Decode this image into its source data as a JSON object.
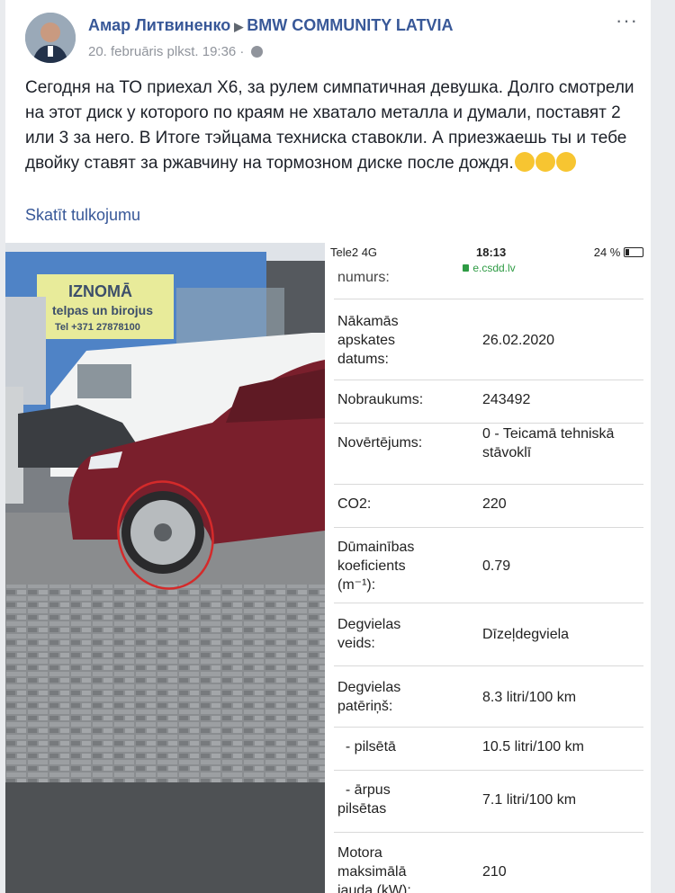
{
  "post": {
    "author": "Амар Литвиненко",
    "group": "BMW COMMUNITY LATVIA",
    "timestamp": "20. februāris plkst. 19:36 ·",
    "text": "Сегодня на ТО приехал X6, за рулем симпатичная девушка. Долго смотрели на этот диск у которого по краям не хватало металла и думали, поставят 2 или 3 за него. В Итоге тэйцама техниска ставокли. А приезжаешь ты и тебе двойку ставят за ржавчину на тормозном диске после дождя.",
    "see_translation": "Skatīt tulkojumu",
    "more_icon": "···"
  },
  "photo": {
    "sign_title": "IZNOMĀ",
    "sign_sub": "telpas un birojus",
    "sign_phone": "Tel +371 27878100"
  },
  "phone": {
    "carrier": "Tele2  4G",
    "time": "18:13",
    "battery": "24 %",
    "url": "e.csdd.lv",
    "cut_label": "numurs:",
    "rows": [
      {
        "label": "Nākamās\napskates\ndatums:",
        "value": "26.02.2020"
      },
      {
        "label": "Nobraukums:",
        "value": "243492"
      },
      {
        "label": "Novērtējums:",
        "value": "0 - Teicamā tehniskā\nstāvoklī"
      },
      {
        "label": "CO2:",
        "value": "220"
      },
      {
        "label": "Dūmainības\nkoeficients\n(m⁻¹):",
        "value": "0.79"
      },
      {
        "label": "Degvielas\nveids:",
        "value": "Dīzeļdegviela"
      },
      {
        "label": "Degvielas\npatēriņš:",
        "value": "8.3 litri/100 km"
      },
      {
        "label": "  - pilsētā",
        "value": "10.5 litri/100 km"
      },
      {
        "label": "  - ārpus\npilsētas",
        "value": "7.1 litri/100 km"
      },
      {
        "label": "Motora\nmaksimālā\njauda (kW):",
        "value": "210"
      }
    ]
  }
}
